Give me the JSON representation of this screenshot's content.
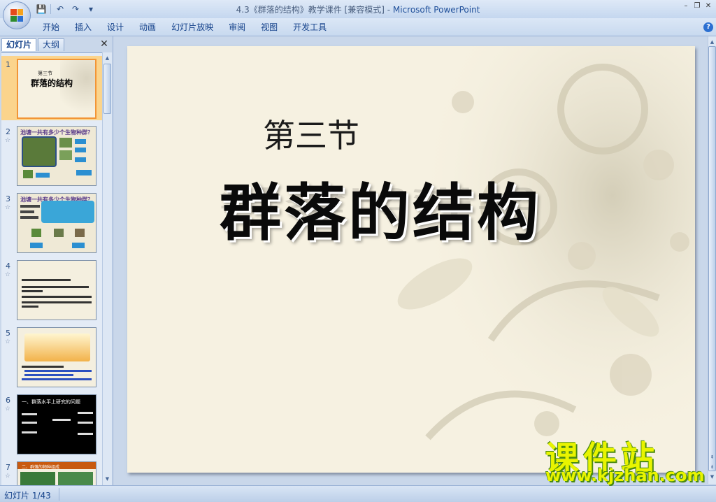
{
  "window": {
    "title_doc": "4.3《群落的结构》教学课件 [兼容模式] -",
    "title_app": "Microsoft PowerPoint",
    "controls": {
      "minimize": "–",
      "restore": "❐",
      "close": "✕"
    }
  },
  "quick_access": {
    "save": "💾",
    "undo": "↶",
    "redo": "↷",
    "customize": "▾"
  },
  "ribbon": {
    "tabs": [
      "开始",
      "插入",
      "设计",
      "动画",
      "幻灯片放映",
      "审阅",
      "视图",
      "开发工具"
    ],
    "help": "?"
  },
  "left_pane": {
    "tab_slides": "幻灯片",
    "tab_outline": "大纲",
    "close": "✕",
    "slides": [
      {
        "num": "1",
        "selected": true,
        "mini_title": "第三节",
        "mini_main": "群落的结构"
      },
      {
        "num": "2",
        "selected": false,
        "mini_title": "池塘一共有多少个生物种群？"
      },
      {
        "num": "3",
        "selected": false,
        "mini_title": "池塘一共有多少个生物种群？"
      },
      {
        "num": "4",
        "selected": false
      },
      {
        "num": "5",
        "selected": false
      },
      {
        "num": "6",
        "selected": false,
        "mini_title": "一、群落水平上研究的问题"
      },
      {
        "num": "7",
        "selected": false,
        "mini_title": "二、群落的物种组成"
      }
    ]
  },
  "slide": {
    "subtitle": "第三节",
    "title": "群落的结构"
  },
  "status": {
    "slide_counter": "幻灯片 1/43"
  },
  "watermark": {
    "main": "课件站",
    "url": "www.kjzhan.com"
  },
  "colors": {
    "accent": "#15428b",
    "selection": "#fbd48c",
    "slide_bg": "#f6f1e1",
    "watermark": "#e8f400"
  }
}
